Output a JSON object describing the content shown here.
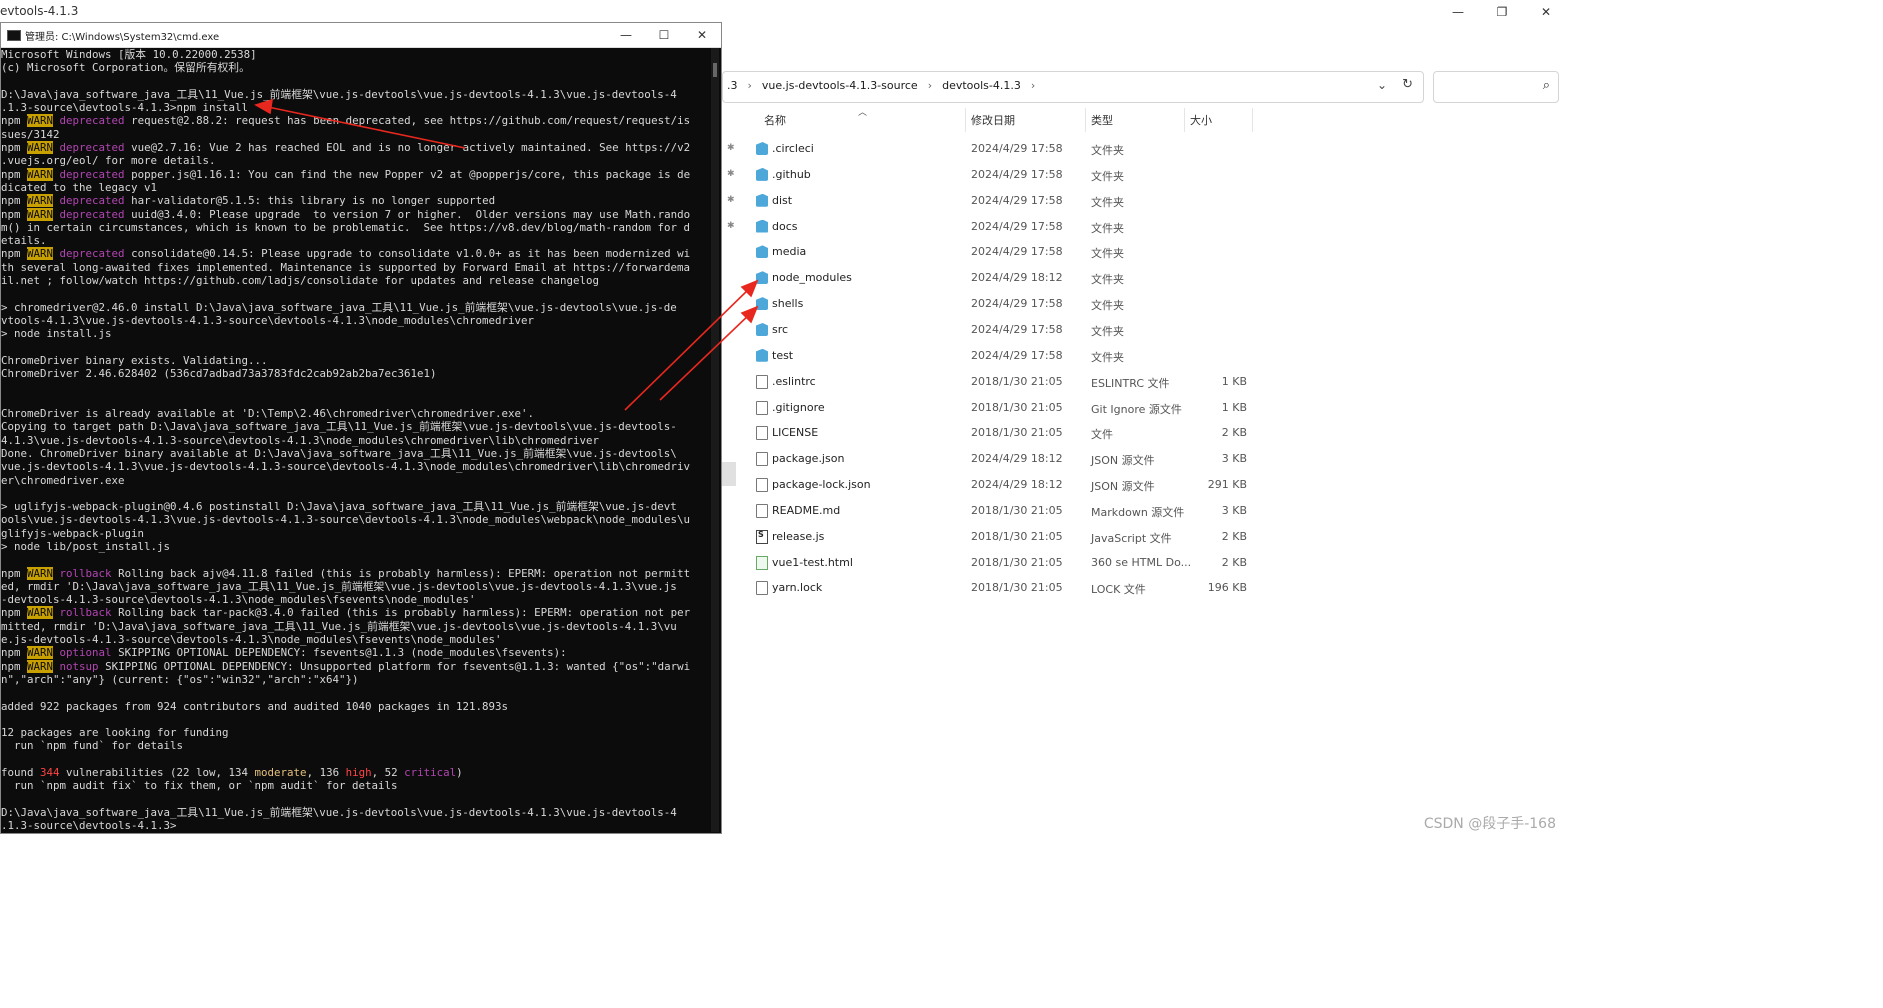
{
  "explorer": {
    "title": "evtools-4.1.3",
    "window_buttons": {
      "minimize": "—",
      "maximize": "❐",
      "close": "✕"
    },
    "breadcrumb": [
      ".3",
      "vue.js-devtools-4.1.3-source",
      "devtools-4.1.3"
    ],
    "columns": {
      "name": "名称",
      "date": "修改日期",
      "type": "类型",
      "size": "大小"
    },
    "files": [
      {
        "name": ".circleci",
        "date": "2024/4/29 17:58",
        "type": "文件夹",
        "size": "",
        "kind": "folder",
        "pinned": true
      },
      {
        "name": ".github",
        "date": "2024/4/29 17:58",
        "type": "文件夹",
        "size": "",
        "kind": "folder",
        "pinned": true
      },
      {
        "name": "dist",
        "date": "2024/4/29 17:58",
        "type": "文件夹",
        "size": "",
        "kind": "folder",
        "pinned": true
      },
      {
        "name": "docs",
        "date": "2024/4/29 17:58",
        "type": "文件夹",
        "size": "",
        "kind": "folder",
        "pinned": true
      },
      {
        "name": "media",
        "date": "2024/4/29 17:58",
        "type": "文件夹",
        "size": "",
        "kind": "folder",
        "pinned": false
      },
      {
        "name": "node_modules",
        "date": "2024/4/29 18:12",
        "type": "文件夹",
        "size": "",
        "kind": "folder",
        "pinned": false
      },
      {
        "name": "shells",
        "date": "2024/4/29 17:58",
        "type": "文件夹",
        "size": "",
        "kind": "folder",
        "pinned": false
      },
      {
        "name": "src",
        "date": "2024/4/29 17:58",
        "type": "文件夹",
        "size": "",
        "kind": "folder",
        "pinned": false
      },
      {
        "name": "test",
        "date": "2024/4/29 17:58",
        "type": "文件夹",
        "size": "",
        "kind": "folder",
        "pinned": false
      },
      {
        "name": ".eslintrc",
        "date": "2018/1/30 21:05",
        "type": "ESLINTRC 文件",
        "size": "1 KB",
        "kind": "file",
        "pinned": false
      },
      {
        "name": ".gitignore",
        "date": "2018/1/30 21:05",
        "type": "Git Ignore 源文件",
        "size": "1 KB",
        "kind": "file",
        "pinned": false
      },
      {
        "name": "LICENSE",
        "date": "2018/1/30 21:05",
        "type": "文件",
        "size": "2 KB",
        "kind": "file",
        "pinned": false
      },
      {
        "name": "package.json",
        "date": "2024/4/29 18:12",
        "type": "JSON 源文件",
        "size": "3 KB",
        "kind": "file",
        "pinned": false
      },
      {
        "name": "package-lock.json",
        "date": "2024/4/29 18:12",
        "type": "JSON 源文件",
        "size": "291 KB",
        "kind": "file",
        "pinned": false
      },
      {
        "name": "README.md",
        "date": "2018/1/30 21:05",
        "type": "Markdown 源文件",
        "size": "3 KB",
        "kind": "file",
        "pinned": false
      },
      {
        "name": "release.js",
        "date": "2018/1/30 21:05",
        "type": "JavaScript 文件",
        "size": "2 KB",
        "kind": "js",
        "pinned": false
      },
      {
        "name": "vue1-test.html",
        "date": "2018/1/30 21:05",
        "type": "360 se HTML Do...",
        "size": "2 KB",
        "kind": "html",
        "pinned": false
      },
      {
        "name": "yarn.lock",
        "date": "2018/1/30 21:05",
        "type": "LOCK 文件",
        "size": "196 KB",
        "kind": "file",
        "pinned": false
      }
    ]
  },
  "cmd": {
    "title": "管理员: C:\\Windows\\System32\\cmd.exe",
    "buttons": {
      "minimize": "—",
      "maximize": "☐",
      "close": "✕"
    },
    "lines": [
      [
        {
          "t": "Microsoft Windows [版本 10.0.22000.2538]"
        }
      ],
      [
        {
          "t": "(c) Microsoft Corporation。保留所有权利。"
        }
      ],
      [
        {
          "t": ""
        }
      ],
      [
        {
          "t": "D:\\Java\\java_software_java_工具\\11_Vue.js_前端框架\\vue.js-devtools\\vue.js-devtools-4.1.3\\vue.js-devtools-4"
        }
      ],
      [
        {
          "t": ".1.3-source\\devtools-4.1.3>npm install"
        }
      ],
      [
        {
          "t": "npm "
        },
        {
          "t": "WARN",
          "c": "warn"
        },
        {
          "t": " "
        },
        {
          "t": "deprecated",
          "c": "mag"
        },
        {
          "t": " request@2.88.2: request has been deprecated, see https://github.com/request/request/is"
        }
      ],
      [
        {
          "t": "sues/3142"
        }
      ],
      [
        {
          "t": "npm "
        },
        {
          "t": "WARN",
          "c": "warn"
        },
        {
          "t": " "
        },
        {
          "t": "deprecated",
          "c": "mag"
        },
        {
          "t": " vue@2.7.16: Vue 2 has reached EOL and is no longer actively maintained. See https://v2"
        }
      ],
      [
        {
          "t": ".vuejs.org/eol/ for more details."
        }
      ],
      [
        {
          "t": "npm "
        },
        {
          "t": "WARN",
          "c": "warn"
        },
        {
          "t": " "
        },
        {
          "t": "deprecated",
          "c": "mag"
        },
        {
          "t": " popper.js@1.16.1: You can find the new Popper v2 at @popperjs/core, this package is de"
        }
      ],
      [
        {
          "t": "dicated to the legacy v1"
        }
      ],
      [
        {
          "t": "npm "
        },
        {
          "t": "WARN",
          "c": "warn"
        },
        {
          "t": " "
        },
        {
          "t": "deprecated",
          "c": "mag"
        },
        {
          "t": " har-validator@5.1.5: this library is no longer supported"
        }
      ],
      [
        {
          "t": "npm "
        },
        {
          "t": "WARN",
          "c": "warn"
        },
        {
          "t": " "
        },
        {
          "t": "deprecated",
          "c": "mag"
        },
        {
          "t": " uuid@3.4.0: Please upgrade  to version 7 or higher.  Older versions may use Math.rando"
        }
      ],
      [
        {
          "t": "m() in certain circumstances, which is known to be problematic.  See https://v8.dev/blog/math-random for d"
        }
      ],
      [
        {
          "t": "etails."
        }
      ],
      [
        {
          "t": "npm "
        },
        {
          "t": "WARN",
          "c": "warn"
        },
        {
          "t": " "
        },
        {
          "t": "deprecated",
          "c": "mag"
        },
        {
          "t": " consolidate@0.14.5: Please upgrade to consolidate v1.0.0+ as it has been modernized wi"
        }
      ],
      [
        {
          "t": "th several long-awaited fixes implemented. Maintenance is supported by Forward Email at https://forwardema"
        }
      ],
      [
        {
          "t": "il.net ; follow/watch https://github.com/ladjs/consolidate for updates and release changelog"
        }
      ],
      [
        {
          "t": ""
        }
      ],
      [
        {
          "t": "> chromedriver@2.46.0 install D:\\Java\\java_software_java_工具\\11_Vue.js_前端框架\\vue.js-devtools\\vue.js-de"
        }
      ],
      [
        {
          "t": "vtools-4.1.3\\vue.js-devtools-4.1.3-source\\devtools-4.1.3\\node_modules\\chromedriver"
        }
      ],
      [
        {
          "t": "> node install.js"
        }
      ],
      [
        {
          "t": ""
        }
      ],
      [
        {
          "t": "ChromeDriver binary exists. Validating..."
        }
      ],
      [
        {
          "t": "ChromeDriver 2.46.628402 (536cd7adbad73a3783fdc2cab92ab2ba7ec361e1)"
        }
      ],
      [
        {
          "t": ""
        }
      ],
      [
        {
          "t": ""
        }
      ],
      [
        {
          "t": "ChromeDriver is already available at 'D:\\Temp\\2.46\\chromedriver\\chromedriver.exe'."
        }
      ],
      [
        {
          "t": "Copying to target path D:\\Java\\java_software_java_工具\\11_Vue.js_前端框架\\vue.js-devtools\\vue.js-devtools-"
        }
      ],
      [
        {
          "t": "4.1.3\\vue.js-devtools-4.1.3-source\\devtools-4.1.3\\node_modules\\chromedriver\\lib\\chromedriver"
        }
      ],
      [
        {
          "t": "Done. ChromeDriver binary available at D:\\Java\\java_software_java_工具\\11_Vue.js_前端框架\\vue.js-devtools\\"
        }
      ],
      [
        {
          "t": "vue.js-devtools-4.1.3\\vue.js-devtools-4.1.3-source\\devtools-4.1.3\\node_modules\\chromedriver\\lib\\chromedriv"
        }
      ],
      [
        {
          "t": "er\\chromedriver.exe"
        }
      ],
      [
        {
          "t": ""
        }
      ],
      [
        {
          "t": "> uglifyjs-webpack-plugin@0.4.6 postinstall D:\\Java\\java_software_java_工具\\11_Vue.js_前端框架\\vue.js-devt"
        }
      ],
      [
        {
          "t": "ools\\vue.js-devtools-4.1.3\\vue.js-devtools-4.1.3-source\\devtools-4.1.3\\node_modules\\webpack\\node_modules\\u"
        }
      ],
      [
        {
          "t": "glifyjs-webpack-plugin"
        }
      ],
      [
        {
          "t": "> node lib/post_install.js"
        }
      ],
      [
        {
          "t": ""
        }
      ],
      [
        {
          "t": "npm "
        },
        {
          "t": "WARN",
          "c": "warn"
        },
        {
          "t": " "
        },
        {
          "t": "rollback",
          "c": "mag"
        },
        {
          "t": " Rolling back ajv@4.11.8 failed (this is probably harmless): EPERM: operation not permitt"
        }
      ],
      [
        {
          "t": "ed, rmdir 'D:\\Java\\java_software_java_工具\\11_Vue.js_前端框架\\vue.js-devtools\\vue.js-devtools-4.1.3\\vue.js"
        }
      ],
      [
        {
          "t": "-devtools-4.1.3-source\\devtools-4.1.3\\node_modules\\fsevents\\node_modules'"
        }
      ],
      [
        {
          "t": "npm "
        },
        {
          "t": "WARN",
          "c": "warn"
        },
        {
          "t": " "
        },
        {
          "t": "rollback",
          "c": "mag"
        },
        {
          "t": " Rolling back tar-pack@3.4.0 failed (this is probably harmless): EPERM: operation not per"
        }
      ],
      [
        {
          "t": "mitted, rmdir 'D:\\Java\\java_software_java_工具\\11_Vue.js_前端框架\\vue.js-devtools\\vue.js-devtools-4.1.3\\vu"
        }
      ],
      [
        {
          "t": "e.js-devtools-4.1.3-source\\devtools-4.1.3\\node_modules\\fsevents\\node_modules'"
        }
      ],
      [
        {
          "t": "npm "
        },
        {
          "t": "WARN",
          "c": "warn"
        },
        {
          "t": " "
        },
        {
          "t": "optional",
          "c": "mag"
        },
        {
          "t": " SKIPPING OPTIONAL DEPENDENCY: fsevents@1.1.3 (node_modules\\fsevents):"
        }
      ],
      [
        {
          "t": "npm "
        },
        {
          "t": "WARN",
          "c": "warn"
        },
        {
          "t": " "
        },
        {
          "t": "notsup",
          "c": "mag"
        },
        {
          "t": " SKIPPING OPTIONAL DEPENDENCY: Unsupported platform for fsevents@1.1.3: wanted {\"os\":\"darwi"
        }
      ],
      [
        {
          "t": "n\",\"arch\":\"any\"} (current: {\"os\":\"win32\",\"arch\":\"x64\"})"
        }
      ],
      [
        {
          "t": ""
        }
      ],
      [
        {
          "t": "added 922 packages from 924 contributors and audited 1040 packages in 121.893s"
        }
      ],
      [
        {
          "t": ""
        }
      ],
      [
        {
          "t": "12 packages are looking for funding"
        }
      ],
      [
        {
          "t": "  run `npm fund` for details"
        }
      ],
      [
        {
          "t": ""
        }
      ],
      [
        {
          "t": "found "
        },
        {
          "t": "344",
          "c": "red"
        },
        {
          "t": " vulnerabilities (22 low, 134 "
        },
        {
          "t": "moderate",
          "c": "yel"
        },
        {
          "t": ", 136 "
        },
        {
          "t": "high",
          "c": "red"
        },
        {
          "t": ", 52 "
        },
        {
          "t": "critical",
          "c": "mag"
        },
        {
          "t": ")"
        }
      ],
      [
        {
          "t": "  run `npm audit fix` to fix them, or `npm audit` for details"
        }
      ],
      [
        {
          "t": ""
        }
      ],
      [
        {
          "t": "D:\\Java\\java_software_java_工具\\11_Vue.js_前端框架\\vue.js-devtools\\vue.js-devtools-4.1.3\\vue.js-devtools-4"
        }
      ],
      [
        {
          "t": ".1.3-source\\devtools-4.1.3>"
        }
      ]
    ]
  },
  "watermark": "CSDN @段子手-168",
  "colors": {
    "arrow": "#e8281e",
    "warn_bg": "#c8a000",
    "deprecated": "#b145b1",
    "folder": "#4da7d9"
  }
}
